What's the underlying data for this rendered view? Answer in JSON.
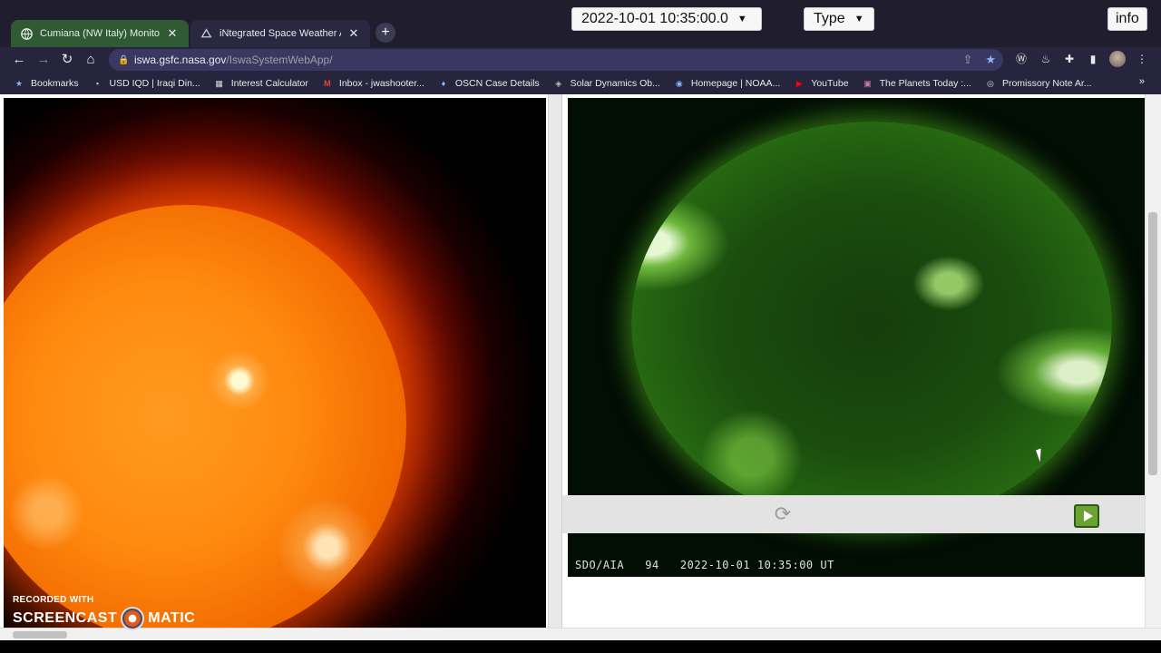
{
  "tabs": [
    {
      "title": "Cumiana (NW Italy) Monitoring S",
      "active": true
    },
    {
      "title": "iNtegrated Space Weather Analy",
      "active": false
    }
  ],
  "address": {
    "host": "iswa.gsfc.nasa.gov",
    "path": "/IswaSystemWebApp/"
  },
  "bookmarks": [
    {
      "label": "Bookmarks",
      "icon": "star-icon"
    },
    {
      "label": "USD IQD | Iraqi Din...",
      "icon": "site-icon"
    },
    {
      "label": "Interest Calculator",
      "icon": "calculator-icon"
    },
    {
      "label": "Inbox - jwashooter...",
      "icon": "gmail-icon"
    },
    {
      "label": "OSCN Case Details",
      "icon": "site-icon"
    },
    {
      "label": "Solar Dynamics Ob...",
      "icon": "site-icon"
    },
    {
      "label": "Homepage | NOAA...",
      "icon": "site-icon"
    },
    {
      "label": "YouTube",
      "icon": "youtube-icon"
    },
    {
      "label": "The Planets Today :...",
      "icon": "site-icon"
    },
    {
      "label": "Promissory Note Ar...",
      "icon": "site-icon"
    }
  ],
  "sdo_caption": "SDO/AIA   94   2022-10-01 10:35:00 UT",
  "controls": {
    "datetime": "2022-10-01 10:35:00.0",
    "type_label": "Type",
    "info_label": "info"
  },
  "watermark": {
    "top": "RECORDED WITH",
    "left": "SCREENCAST",
    "right": "MATIC"
  },
  "colors": {
    "accent": "#8ab4f8",
    "active_tab": "#2f5a33"
  }
}
